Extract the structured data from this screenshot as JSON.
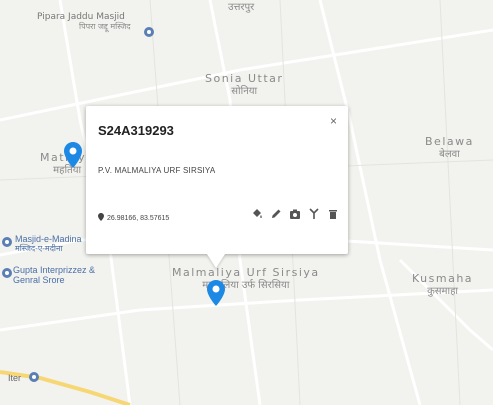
{
  "map": {
    "places": [
      {
        "en": "Pipara Jaddu Masjid",
        "hi": "पिपरा जद्दू मस्जिद"
      },
      {
        "en": "Sonia Uttar",
        "hi": "सोनिया"
      },
      {
        "en": "Mathiya",
        "hi": "महतिया"
      },
      {
        "en": "Belawa",
        "hi": "बेलवा"
      },
      {
        "en": "Malmaliya Urf Sirsiya",
        "hi": "मलमलिया उर्फ सिरसिया"
      },
      {
        "en": "Kusmaha",
        "hi": "कुसमाहा"
      }
    ],
    "pois": [
      {
        "en": "Masjid-e-Madina",
        "hi": "मस्जिद-ए-मदीना"
      },
      {
        "en": "Gupta Interprizzez & Genral Srore",
        "hi": ""
      },
      {
        "en": "Iter",
        "hi": ""
      }
    ],
    "top_partial": "उत्तरपुर"
  },
  "popup": {
    "title": "S24A319293",
    "close": "×",
    "address": "P.V. MALMALIYA URF SIRSIYA",
    "coordinates": "26.98166, 83.57615",
    "actions": [
      "paint-bucket-icon",
      "pencil-icon",
      "camera-icon",
      "antenna-icon",
      "trash-icon"
    ]
  },
  "colors": {
    "marker": "#1e88e5",
    "road_yellow": "#f7d774",
    "road_white": "#ffffff",
    "poi_text": "#4a6fa5"
  }
}
